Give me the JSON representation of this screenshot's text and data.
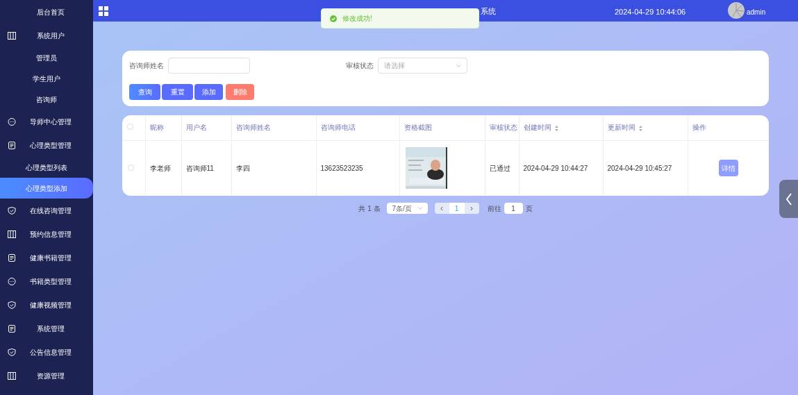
{
  "sidebar": {
    "items": [
      {
        "label": "后台首页",
        "kind": "plain",
        "selected": false
      },
      {
        "label": "系统用户",
        "kind": "columns",
        "selected": false,
        "children": [
          {
            "label": "管理员",
            "selected": false
          },
          {
            "label": "学生用户",
            "selected": false
          },
          {
            "label": "咨询师",
            "selected": false
          }
        ]
      },
      {
        "label": "导师中心管理",
        "kind": "chat",
        "selected": false
      },
      {
        "label": "心理类型管理",
        "kind": "doc",
        "selected": false,
        "children": [
          {
            "label": "心理类型列表",
            "selected": false
          },
          {
            "label": "心理类型添加",
            "selected": true
          }
        ]
      },
      {
        "label": "在线咨询管理",
        "kind": "shield",
        "selected": false
      },
      {
        "label": "预约信息管理",
        "kind": "columns",
        "selected": false
      },
      {
        "label": "健康书籍管理",
        "kind": "doc",
        "selected": false
      },
      {
        "label": "书籍类型管理",
        "kind": "chat",
        "selected": false
      },
      {
        "label": "健康视频管理",
        "kind": "shield",
        "selected": false
      },
      {
        "label": "系统管理",
        "kind": "doc",
        "selected": false
      },
      {
        "label": "公告信息管理",
        "kind": "shield",
        "selected": false
      },
      {
        "label": "资源管理",
        "kind": "columns",
        "selected": false
      }
    ]
  },
  "header": {
    "title": "系统",
    "datetime": "2024-04-29 10:44:06",
    "user": "admin"
  },
  "toast": {
    "message": "修改成功!"
  },
  "search": {
    "fields": [
      {
        "label": "咨询师姓名",
        "kind": "input"
      },
      {
        "label": "审核状态",
        "kind": "select",
        "placeholder": "请选择"
      }
    ],
    "buttons": [
      {
        "label": "查询",
        "kind": "primary"
      },
      {
        "label": "重置",
        "kind": "indigo"
      },
      {
        "label": "添加",
        "kind": "indigo"
      },
      {
        "label": "删除",
        "kind": "danger"
      }
    ]
  },
  "table": {
    "select_all_checked": false,
    "columns": [
      {
        "label": "昵称",
        "sortable": false
      },
      {
        "label": "用户名",
        "sortable": false
      },
      {
        "label": "咨询师姓名",
        "sortable": false
      },
      {
        "label": "咨询师电话",
        "sortable": false
      },
      {
        "label": "资格截图",
        "sortable": false
      },
      {
        "label": "审核状态",
        "sortable": false
      },
      {
        "label": "创建时间",
        "sortable": true
      },
      {
        "label": "更新时间",
        "sortable": true
      },
      {
        "label": "操作",
        "sortable": false
      }
    ],
    "rows": [
      {
        "checked": false,
        "cells": [
          "李老师",
          "咨询师11",
          "李四",
          "13623523235",
          {
            "kind": "picture"
          },
          "已通过",
          "2024-04-29 10:44:27",
          "2024-04-29 10:45:27"
        ],
        "action": "详情"
      }
    ]
  },
  "pagination": {
    "total": "共 1 条",
    "page_size": "7条/页",
    "prev": "‹",
    "page": "1",
    "next": "›",
    "goto_label": "前往",
    "goto_value": "1",
    "page_unit": "页"
  }
}
